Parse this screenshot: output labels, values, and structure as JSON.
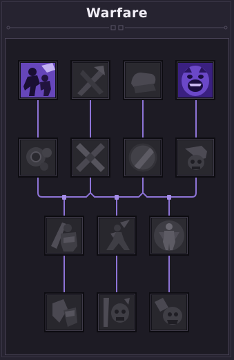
{
  "title": "Warfare",
  "colors": {
    "active_line": "#8e74d8",
    "active_icon": "#7d5ad8",
    "inactive_icon": "#3b3a41",
    "frame": "#4a4458",
    "background": "#1d1b24"
  },
  "nodes": [
    {
      "tier": 1,
      "column": 1,
      "icon": "charging-figure-icon",
      "unlocked": true
    },
    {
      "tier": 1,
      "column": 2,
      "icon": "crossed-axes-icon",
      "unlocked": false
    },
    {
      "tier": 1,
      "column": 3,
      "icon": "grip-hand-icon",
      "unlocked": false
    },
    {
      "tier": 1,
      "column": 4,
      "icon": "roaring-face-icon",
      "unlocked": true
    },
    {
      "tier": 2,
      "column": 1,
      "icon": "gear-target-icon",
      "unlocked": false
    },
    {
      "tier": 2,
      "column": 2,
      "icon": "crossed-swords-icon",
      "unlocked": false
    },
    {
      "tier": 2,
      "column": 3,
      "icon": "shield-slash-icon",
      "unlocked": false
    },
    {
      "tier": 2,
      "column": 4,
      "icon": "skull-fist-icon",
      "unlocked": false
    },
    {
      "tier": 3,
      "column": 1,
      "icon": "armored-warrior-icon",
      "unlocked": false
    },
    {
      "tier": 3,
      "column": 2,
      "icon": "lunging-figure-icon",
      "unlocked": false
    },
    {
      "tier": 3,
      "column": 3,
      "icon": "glowing-figure-icon",
      "unlocked": false
    },
    {
      "tier": 4,
      "column": 1,
      "icon": "shield-hammer-icon",
      "unlocked": false
    },
    {
      "tier": 4,
      "column": 2,
      "icon": "skull-blade-icon",
      "unlocked": false
    },
    {
      "tier": 4,
      "column": 3,
      "icon": "gauntlet-icon",
      "unlocked": false
    }
  ]
}
